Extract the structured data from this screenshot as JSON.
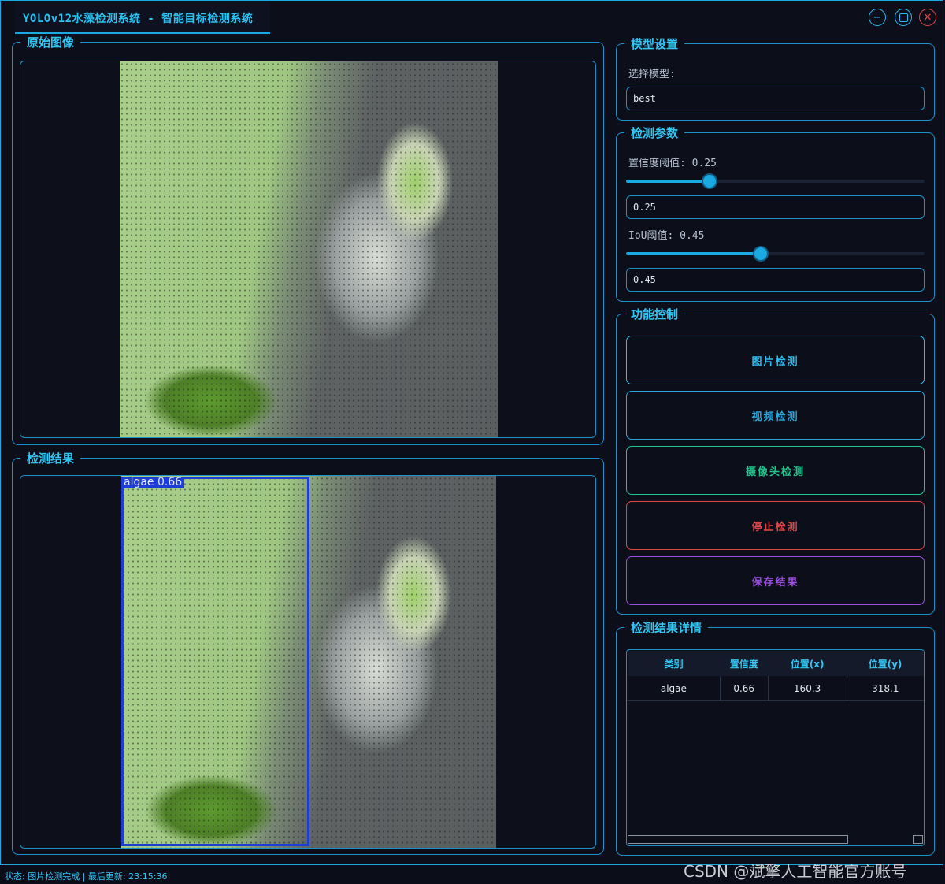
{
  "window": {
    "title": "YOLOv12水藻检测系统 - 智能目标检测系统",
    "minimize_glyph": "−",
    "close_glyph": "✕"
  },
  "original_panel": {
    "title": "原始图像"
  },
  "result_panel": {
    "title": "检测结果",
    "detection_label": "algae 0.66"
  },
  "model_settings": {
    "title": "模型设置",
    "select_label": "选择模型:",
    "selected_model": "best"
  },
  "detection_params": {
    "title": "检测参数",
    "conf_label": "置信度阈值: 0.25",
    "conf_value": "0.25",
    "conf_fraction": 0.25,
    "iou_label": "IoU阈值: 0.45",
    "iou_value": "0.45",
    "iou_fraction": 0.45
  },
  "function_control": {
    "title": "功能控制",
    "buttons": [
      {
        "label": "图片检测",
        "color": "#2fbef0"
      },
      {
        "label": "视频检测",
        "color": "#2aa7dc"
      },
      {
        "label": "摄像头检测",
        "color": "#23c48d"
      },
      {
        "label": "停止检测",
        "color": "#e04848"
      },
      {
        "label": "保存结果",
        "color": "#9b4fe0"
      }
    ]
  },
  "result_details": {
    "title": "检测结果详情",
    "columns": [
      "类别",
      "置信度",
      "位置(x)",
      "位置(y)"
    ],
    "rows": [
      [
        "algae",
        "0.66",
        "160.3",
        "318.1"
      ]
    ]
  },
  "status_bar": {
    "text": "状态: 图片检测完成 | 最后更新: 23:15:36"
  },
  "watermark": "CSDN @斌擎人工智能官方账号",
  "colors": {
    "accent": "#1aa9e0",
    "title": "#34c5f3",
    "background": "#0c0f1a"
  }
}
